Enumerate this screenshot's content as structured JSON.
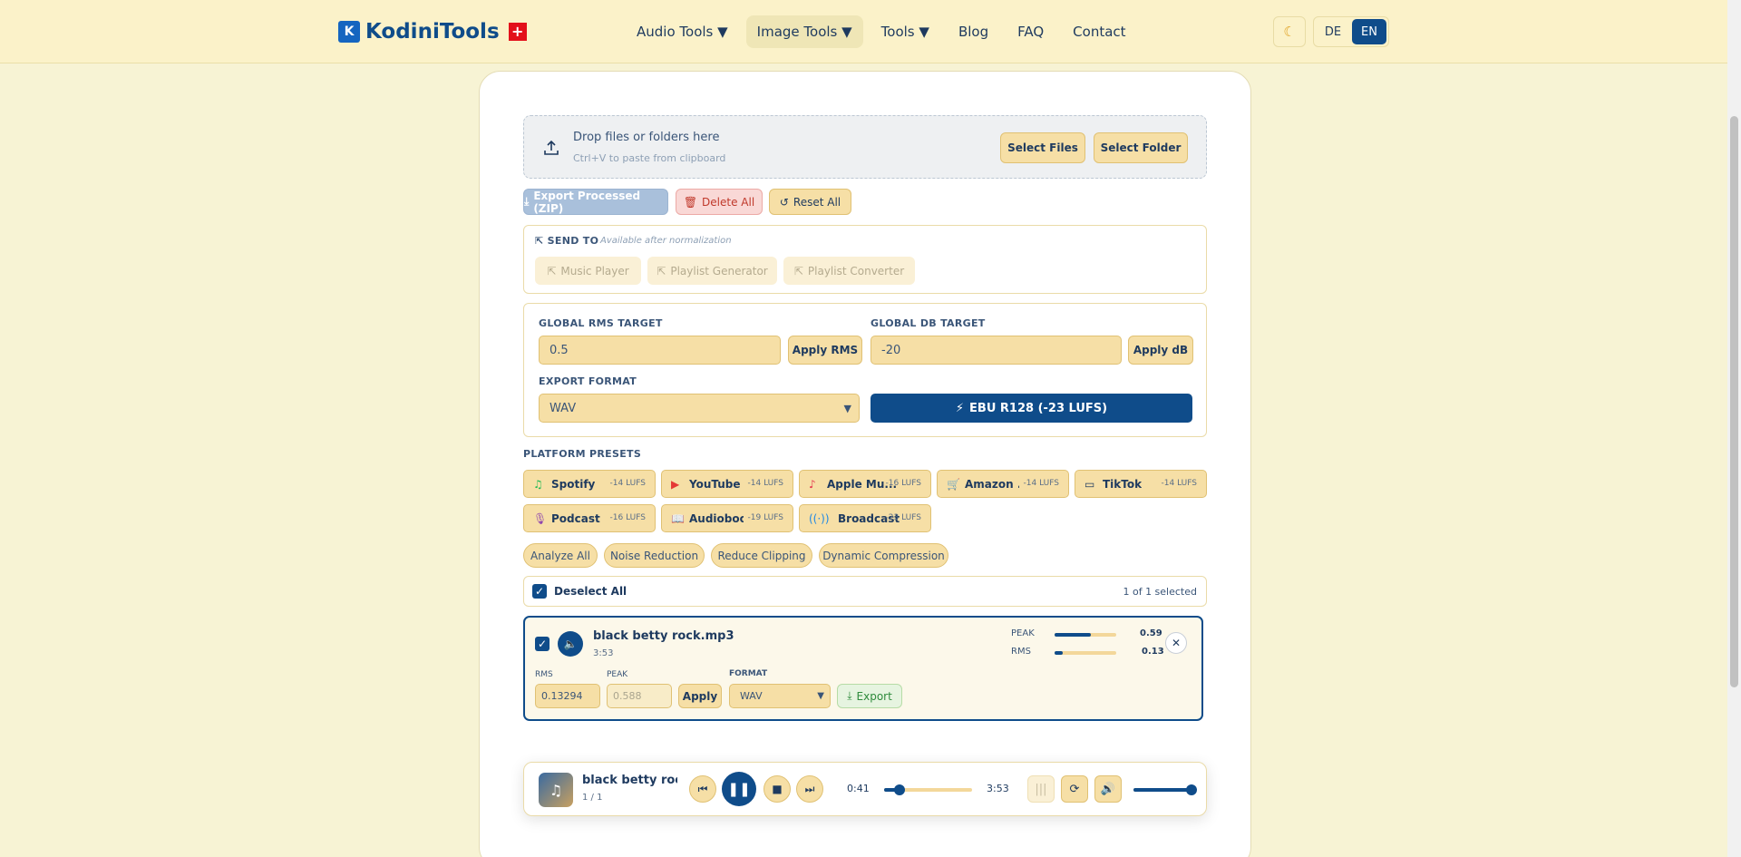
{
  "nav": {
    "brand": "KodiniTools",
    "links": [
      "Audio Tools ▼",
      "Image Tools ▼",
      "Tools ▼",
      "Blog",
      "FAQ",
      "Contact"
    ],
    "theme_icon": "moon-icon",
    "langs": [
      "DE",
      "EN"
    ]
  },
  "drop": {
    "title": "Drop files or folders here",
    "hint": "Ctrl+V to paste from clipboard",
    "select_files": "Select Files",
    "select_folder": "Select Folder"
  },
  "actions": {
    "export_zip": "Export Processed (ZIP)",
    "delete_all": "Delete All",
    "reset_all": "Reset All"
  },
  "send_to": {
    "label": "SEND TO",
    "note": "Available after normalization",
    "targets": [
      "Music Player",
      "Playlist Generator",
      "Playlist Converter"
    ]
  },
  "settings": {
    "rms_label": "GLOBAL RMS TARGET",
    "rms_value": "0.5",
    "apply_rms": "Apply RMS",
    "db_label": "GLOBAL DB TARGET",
    "db_value": "-20",
    "apply_db": "Apply dB",
    "format_label": "EXPORT FORMAT",
    "format_value": "WAV",
    "ebu": "EBU R128 (-23 LUFS)"
  },
  "presets": {
    "label": "PLATFORM PRESETS",
    "items": [
      {
        "name": "Spotify",
        "lufs": "-14 LUFS"
      },
      {
        "name": "YouTube",
        "lufs": "-14 LUFS"
      },
      {
        "name": "Apple Mu...",
        "lufs": "-16 LUFS"
      },
      {
        "name": "Amazon ...",
        "lufs": "-14 LUFS"
      },
      {
        "name": "TikTok",
        "lufs": "-14 LUFS"
      },
      {
        "name": "Podcast",
        "lufs": "-16 LUFS"
      },
      {
        "name": "Audioboo...",
        "lufs": "-19 LUFS"
      },
      {
        "name": "Broadcast",
        "lufs": "-23 LUFS"
      }
    ]
  },
  "tools": [
    "Analyze All",
    "Noise Reduction",
    "Reduce Clipping",
    "Dynamic Compression"
  ],
  "selection": {
    "deselect": "Deselect All",
    "count": "1 of 1 selected"
  },
  "file": {
    "name": "black betty rock.mp3",
    "duration": "3:53",
    "peak_label": "PEAK",
    "peak_value": "0.59",
    "peak_level": 0.59,
    "rms_label": "RMS",
    "rms_value": "0.13",
    "rms_level": 0.13,
    "rms_field_label": "RMS",
    "rms_field": "0.13294",
    "peak_field_label": "PEAK",
    "peak_field": "0.588",
    "apply": "Apply",
    "format_label": "FORMAT",
    "format": "WAV",
    "export": "Export"
  },
  "player": {
    "title": "black betty rock...",
    "track": "1 / 1",
    "current": "0:41",
    "total": "3:53",
    "progress": 0.18,
    "volume": 1.0
  }
}
